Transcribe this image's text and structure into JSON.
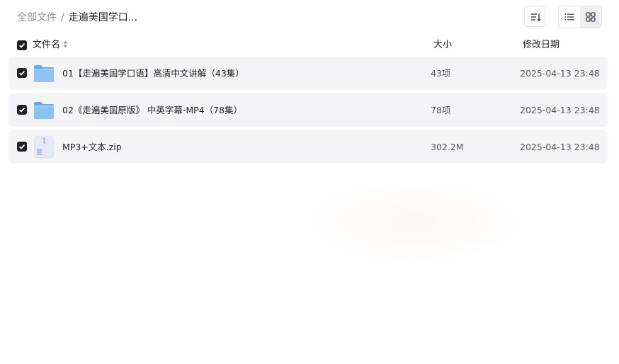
{
  "breadcrumb": {
    "root": "全部文件",
    "separator": "/",
    "current": "走遍美国学口..."
  },
  "toolbar": {
    "sort_icon": "sort-icon",
    "list_view_icon": "list-view-icon",
    "grid_view_icon": "grid-view-icon"
  },
  "table": {
    "headers": {
      "name": "文件名",
      "size": "大小",
      "date": "修改日期"
    },
    "rows": [
      {
        "name": "01【走遍美国学口语】高清中文讲解（43集）",
        "size": "43项",
        "date": "2025-04-13 23:48",
        "type": "folder",
        "checked": true
      },
      {
        "name": "02《走遍美国原版》 中英字幕-MP4（78集）",
        "size": "78项",
        "date": "2025-04-13 23:48",
        "type": "folder",
        "checked": true
      },
      {
        "name": "MP3+文本.zip",
        "size": "302.2M",
        "date": "2025-04-13 23:48",
        "type": "zip",
        "checked": true
      }
    ]
  },
  "colors": {
    "checkbox": "#1f1f24",
    "row_bg": "#f4f4f6",
    "folder": "#7eb6f2",
    "muted_text": "#8c8f99"
  }
}
